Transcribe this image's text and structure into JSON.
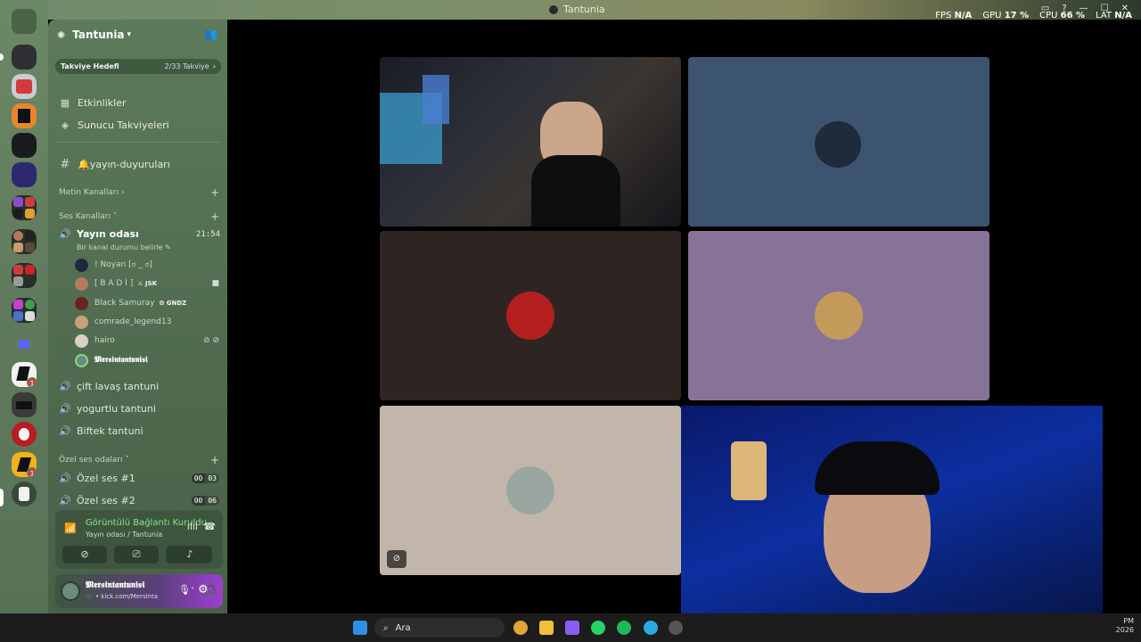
{
  "window": {
    "title": "Tantunia",
    "nav_label": "← →"
  },
  "stats": {
    "fps_label": "FPS",
    "fps_value": "N/A",
    "gpu_label": "GPU",
    "gpu_value": "17 %",
    "cpu_label": "CPU",
    "cpu_value": "66 %",
    "lat_label": "LAT",
    "lat_value": "N/A"
  },
  "server": {
    "name": "Tantunia",
    "boost_label": "Takviye Hedefi",
    "boost_progress": "2/33 Takviye"
  },
  "menu": {
    "events": "Etkinlikler",
    "boosts": "Sunucu Takviyeleri",
    "announce_channel": "🔔yayın-duyuruları"
  },
  "categories": {
    "text": "Metin Kanalları",
    "voice": "Ses Kanalları",
    "private_voice": "Özel ses odaları"
  },
  "active_voice": {
    "name": "Yayın odası",
    "time": "21:54",
    "status_prompt": "Bir kanal durumu belirle"
  },
  "members": [
    {
      "name": "! Noyan [ಠ _ ಠ]",
      "tag": ""
    },
    {
      "name": "[ B A D İ ]",
      "tag": "JSK"
    },
    {
      "name": "Black Samuray",
      "tag": "GNDZ"
    },
    {
      "name": "comrade_legend13",
      "tag": ""
    },
    {
      "name": "hairo",
      "tag": ""
    },
    {
      "name": "𝕸𝖊𝖗𝖘𝖎𝖓𝖙𝖆𝖓𝖙𝖚𝖓𝖎𝖘𝖎",
      "tag": ""
    }
  ],
  "voice_channels": [
    {
      "name": "çift lavaş tantuni"
    },
    {
      "name": "yogurtlu tantuni"
    },
    {
      "name": "Biftek tantuni"
    }
  ],
  "private_channels": [
    {
      "name": "Özel ses #1",
      "a": "00",
      "b": "03"
    },
    {
      "name": "Özel ses #2",
      "a": "00",
      "b": "06"
    }
  ],
  "voice_panel": {
    "status": "Görüntülü Bağlantı Kuruldu",
    "location": "Yayın odası / Tantunia"
  },
  "user": {
    "name": "𝕸𝖊𝖗𝖘𝖎𝖓𝖙𝖆𝖓𝖙𝖚𝖓𝖎𝖘𝖎",
    "sub": "🎶 • kick.com/Mersinta"
  },
  "taskbar": {
    "search_placeholder": "Ara",
    "clock_top": "PM",
    "clock_bottom": "2026"
  },
  "colors": {
    "rail": "#5f7a5c",
    "sidebar": "#4f6a4f",
    "tile_blue": "#3d5470",
    "tile_brown": "#2e2522",
    "tile_lilac": "#887398",
    "tile_beige": "#c2b6aa"
  }
}
